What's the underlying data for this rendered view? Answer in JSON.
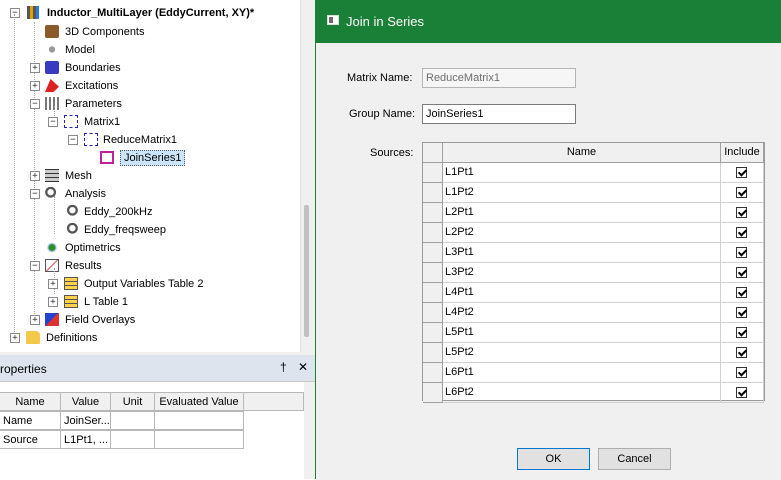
{
  "tree": {
    "root_label": "Inductor_MultiLayer (EddyCurrent, XY)*",
    "nodes": [
      {
        "label": "3D Components"
      },
      {
        "label": "Model"
      },
      {
        "label": "Boundaries"
      },
      {
        "label": "Excitations"
      },
      {
        "label": "Parameters"
      },
      {
        "label": "Matrix1"
      },
      {
        "label": "ReduceMatrix1"
      },
      {
        "label": "JoinSeries1"
      },
      {
        "label": "Mesh"
      },
      {
        "label": "Analysis"
      },
      {
        "label": "Eddy_200kHz"
      },
      {
        "label": "Eddy_freqsweep"
      },
      {
        "label": "Optimetrics"
      },
      {
        "label": "Results"
      },
      {
        "label": "Output Variables Table 2"
      },
      {
        "label": "L Table 1"
      },
      {
        "label": "Field Overlays"
      },
      {
        "label": "Definitions"
      }
    ]
  },
  "properties": {
    "title": "roperties",
    "pin": "†",
    "close": "✕",
    "columns": [
      "Name",
      "Value",
      "Unit",
      "Evaluated Value"
    ],
    "rows": [
      {
        "name": "Name",
        "value": "JoinSer...",
        "unit": "",
        "evaluated": ""
      },
      {
        "name": "Source",
        "value": "L1Pt1, ...",
        "unit": "",
        "evaluated": ""
      }
    ]
  },
  "dialog": {
    "title": "Join in Series",
    "matrix_label": "Matrix Name:",
    "matrix_value": "ReduceMatrix1",
    "group_label": "Group Name:",
    "group_value": "JoinSeries1",
    "sources_label": "Sources:",
    "grid_headers": {
      "name": "Name",
      "include": "Include"
    },
    "sources": [
      {
        "name": "L1Pt1",
        "include": true
      },
      {
        "name": "L1Pt2",
        "include": true
      },
      {
        "name": "L2Pt1",
        "include": true
      },
      {
        "name": "L2Pt2",
        "include": true
      },
      {
        "name": "L3Pt1",
        "include": true
      },
      {
        "name": "L3Pt2",
        "include": true
      },
      {
        "name": "L4Pt1",
        "include": true
      },
      {
        "name": "L4Pt2",
        "include": true
      },
      {
        "name": "L5Pt1",
        "include": true
      },
      {
        "name": "L5Pt2",
        "include": true
      },
      {
        "name": "L6Pt1",
        "include": true
      },
      {
        "name": "L6Pt2",
        "include": true
      }
    ],
    "ok_label": "OK",
    "cancel_label": "Cancel"
  },
  "colors": {
    "title_bar": "#1a7f37",
    "selection": "#cce4f7"
  }
}
